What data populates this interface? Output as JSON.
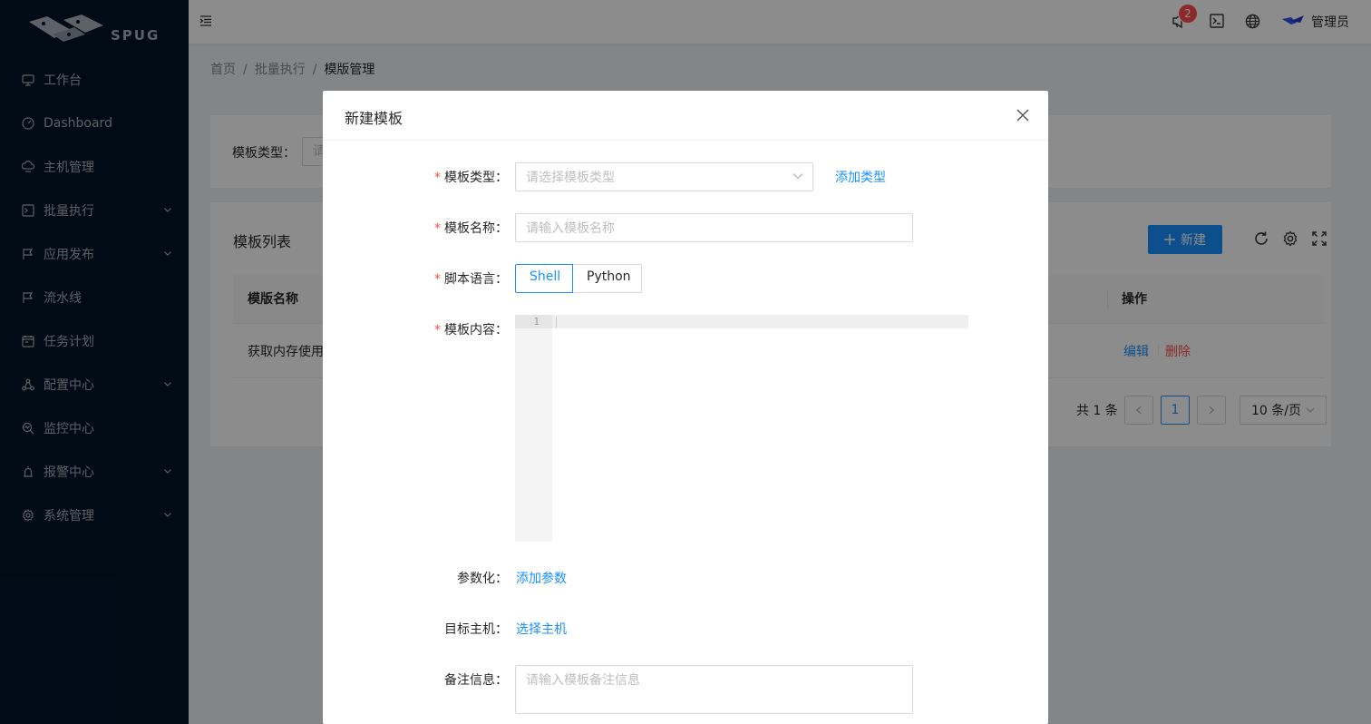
{
  "sidebar": {
    "logo_text": "SPUG",
    "items": [
      {
        "label": "工作台",
        "icon": "desktop-icon",
        "has_sub": false
      },
      {
        "label": "Dashboard",
        "icon": "dashboard-icon",
        "has_sub": false
      },
      {
        "label": "主机管理",
        "icon": "cloud-server-icon",
        "has_sub": false
      },
      {
        "label": "批量执行",
        "icon": "terminal-icon",
        "has_sub": true
      },
      {
        "label": "应用发布",
        "icon": "flag-icon",
        "has_sub": true
      },
      {
        "label": "流水线",
        "icon": "flag-icon",
        "has_sub": false
      },
      {
        "label": "任务计划",
        "icon": "schedule-icon",
        "has_sub": false
      },
      {
        "label": "配置中心",
        "icon": "deployment-icon",
        "has_sub": true
      },
      {
        "label": "监控中心",
        "icon": "monitor-icon",
        "has_sub": false
      },
      {
        "label": "报警中心",
        "icon": "alert-icon",
        "has_sub": true
      },
      {
        "label": "系统管理",
        "icon": "setting-icon",
        "has_sub": true
      }
    ]
  },
  "header": {
    "notification_count": "2",
    "username": "管理员"
  },
  "breadcrumb": {
    "home": "首页",
    "parent": "批量执行",
    "current": "模版管理"
  },
  "filter": {
    "label": "模板类型：",
    "placeholder": "请"
  },
  "table": {
    "title": "模板列表",
    "new_button": "新建",
    "columns": {
      "name": "模版名称",
      "actions": "操作"
    },
    "rows": [
      {
        "name": "获取内存使用",
        "edit": "编辑",
        "delete": "删除"
      }
    ],
    "pagination": {
      "total": "共 1 条",
      "current_page": "1",
      "page_size": "10 条/页"
    }
  },
  "modal": {
    "title": "新建模板",
    "type": {
      "label": "模板类型",
      "placeholder": "请选择模板类型",
      "add_link": "添加类型"
    },
    "name": {
      "label": "模板名称",
      "placeholder": "请输入模板名称"
    },
    "lang": {
      "label": "脚本语言",
      "options": [
        "Shell",
        "Python"
      ],
      "selected": "Shell"
    },
    "content": {
      "label": "模板内容",
      "line_number": "1"
    },
    "params": {
      "label": "参数化",
      "add_link": "添加参数"
    },
    "hosts": {
      "label": "目标主机",
      "select_link": "选择主机"
    },
    "desc": {
      "label": "备注信息",
      "placeholder": "请输入模板备注信息"
    }
  },
  "colors": {
    "primary": "#1890ff",
    "sider": "#001529",
    "danger": "#ff4d4f"
  }
}
